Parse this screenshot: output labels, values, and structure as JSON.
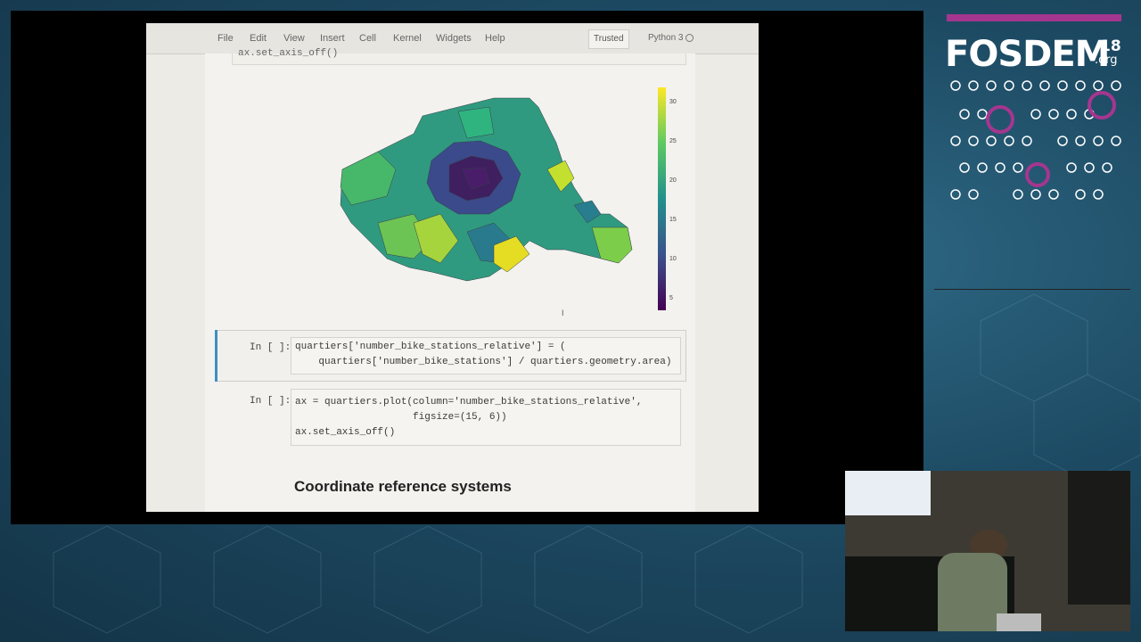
{
  "notebook": {
    "menu": [
      "File",
      "Edit",
      "View",
      "Insert",
      "Cell",
      "Kernel",
      "Widgets",
      "Help"
    ],
    "trusted_label": "Trusted",
    "kernel_name": "Python 3",
    "previous_cell_code": "ax.set_axis_off()",
    "cells": [
      {
        "prompt": "In [ ]:",
        "lines": [
          "quartiers['number_bike_stations_relative'] = (",
          "    quartiers['number_bike_stations'] / quartiers.geometry.area)"
        ]
      },
      {
        "prompt": "In [ ]:",
        "lines": [
          "ax = quartiers.plot(column='number_bike_stations_relative',",
          "                    figsize=(15, 6))",
          "ax.set_axis_off()"
        ]
      }
    ],
    "markdown_heading": "Coordinate reference systems"
  },
  "colorbar": {
    "ticks": [
      "30",
      "25",
      "20",
      "15",
      "10",
      "5"
    ]
  },
  "colors": {
    "accent": "#a5368f",
    "selection": "#3f8ec4"
  },
  "conference": {
    "logo_text": "FOSDEM",
    "year": "18",
    "suffix": ".org"
  }
}
